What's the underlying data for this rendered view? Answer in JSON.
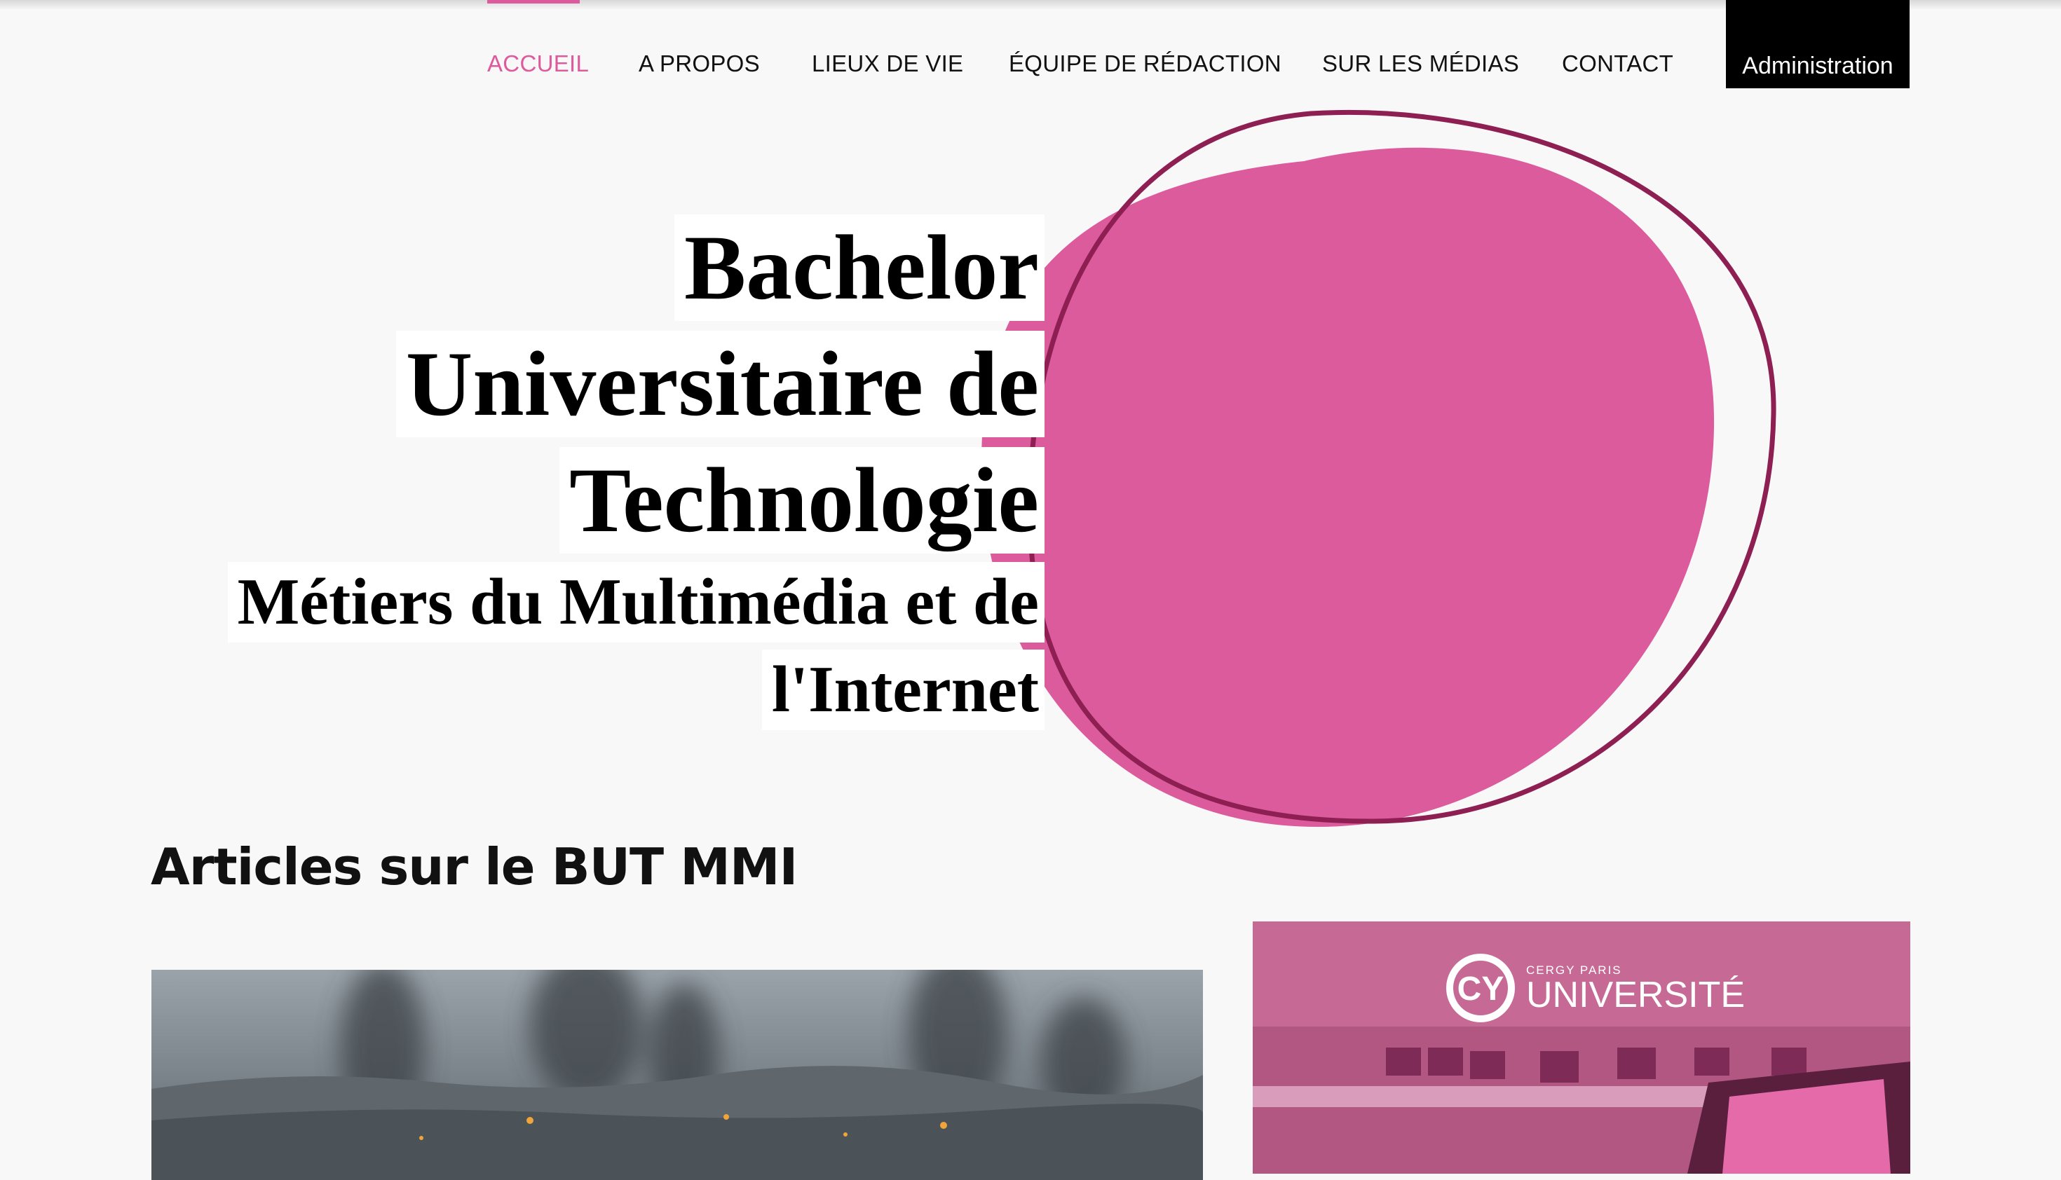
{
  "nav": {
    "items": [
      {
        "label": "ACCUEIL",
        "active": true
      },
      {
        "label": "A PROPOS"
      },
      {
        "label": "LIEUX DE VIE"
      },
      {
        "label": "ÉQUIPE DE RÉDACTION"
      },
      {
        "label": "SUR LES MÉDIAS"
      },
      {
        "label": "CONTACT"
      }
    ],
    "admin_label": "Administration"
  },
  "hero": {
    "title_lines": [
      "Bachelor",
      "Universitaire de",
      "Technologie"
    ],
    "subtitle_lines": [
      "Métiers du Multimédia et de",
      "l'Internet"
    ]
  },
  "articles": {
    "heading": "Articles sur le BUT MMI"
  },
  "logo": {
    "top_text": "CERGY PARIS",
    "name": "UNIVERSITÉ",
    "mark": "CY"
  },
  "colors": {
    "accent": "#dc5b9c",
    "outline": "#8e1f52",
    "admin_bg": "#000000"
  }
}
